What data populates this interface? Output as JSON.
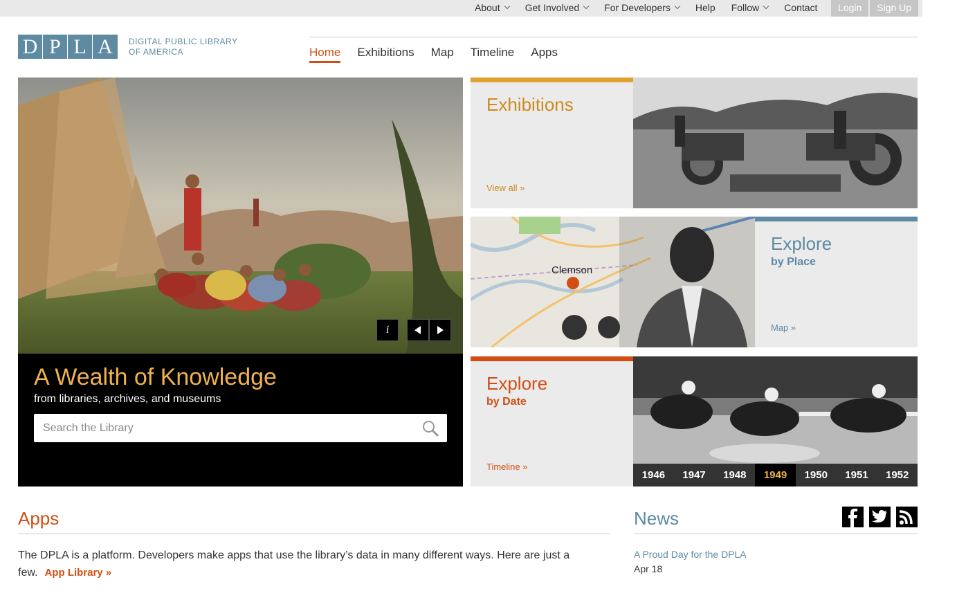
{
  "utility_nav": {
    "items": [
      {
        "label": "About",
        "dropdown": true
      },
      {
        "label": "Get Involved",
        "dropdown": true
      },
      {
        "label": "For Developers",
        "dropdown": true
      },
      {
        "label": "Help",
        "dropdown": false
      },
      {
        "label": "Follow",
        "dropdown": true
      },
      {
        "label": "Contact",
        "dropdown": false
      }
    ],
    "login": "Login",
    "signup": "Sign Up"
  },
  "logo": {
    "letters": [
      "D",
      "P",
      "L",
      "A"
    ],
    "line1": "DIGITAL PUBLIC LIBRARY",
    "line2": "OF AMERICA"
  },
  "main_nav": {
    "items": [
      "Home",
      "Exhibitions",
      "Map",
      "Timeline",
      "Apps"
    ],
    "active": "Home"
  },
  "hero": {
    "title": "A Wealth of Knowledge",
    "subtitle": "from libraries, archives, and museums",
    "search_placeholder": "Search the Library",
    "info_label": "i"
  },
  "tiles": {
    "exhibitions": {
      "title": "Exhibitions",
      "link": "View all »"
    },
    "place": {
      "title": "Explore",
      "subtitle": "by Place",
      "link": "Map »",
      "map_label": "Clemson"
    },
    "date": {
      "title": "Explore",
      "subtitle": "by Date",
      "link": "Timeline »"
    }
  },
  "timeline": {
    "years": [
      "1946",
      "1947",
      "1948",
      "1949",
      "1950",
      "1951",
      "1952"
    ],
    "selected": "1949"
  },
  "apps": {
    "heading": "Apps",
    "text": "The DPLA is a platform. Developers make apps that use the library’s data in many different ways. Here are just a few.",
    "link": "App Library »"
  },
  "news": {
    "heading": "News",
    "item_title": "A Proud Day for the DPLA",
    "item_date": "Apr 18"
  },
  "colors": {
    "accent_orange": "#d24e15",
    "gold": "#e0a22e",
    "blue": "#5e8aa2"
  }
}
